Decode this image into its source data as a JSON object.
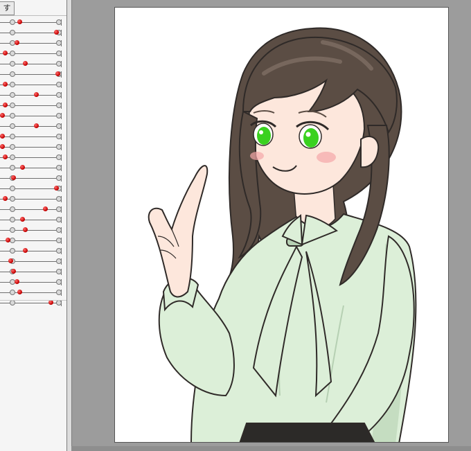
{
  "panel": {
    "tab_label": "す",
    "sliders": [
      {
        "value": 0.3
      },
      {
        "value": 0.95
      },
      {
        "value": 0.25
      },
      {
        "value": 0.05
      },
      {
        "value": 0.4
      },
      {
        "value": 0.98
      },
      {
        "value": 0.05
      },
      {
        "value": 0.6
      },
      {
        "value": 0.05
      },
      {
        "value": 0.0
      },
      {
        "value": 0.6
      },
      {
        "value": 0.0
      },
      {
        "value": 0.0
      },
      {
        "value": 0.05
      },
      {
        "value": 0.35
      },
      {
        "value": 0.2
      },
      {
        "value": 0.95
      },
      {
        "value": 0.05
      },
      {
        "value": 0.75
      },
      {
        "value": 0.35
      },
      {
        "value": 0.4
      },
      {
        "value": 0.1
      },
      {
        "value": 0.4
      },
      {
        "value": 0.15
      },
      {
        "value": 0.2
      },
      {
        "value": 0.25
      },
      {
        "value": 0.3
      },
      {
        "value": 0.85
      }
    ]
  },
  "canvas": {
    "subject": "anime-girl-illustration",
    "colors": {
      "hair": "#5b4d44",
      "hair_highlight": "#8a7a6e",
      "skin": "#fde7dc",
      "blouse": "#dcefd8",
      "blouse_shadow": "#b6d0b3",
      "eyes": "#3ad11f",
      "blush": "#f3a6a8",
      "outline": "#2f2a28",
      "skirt": "#2c2a28"
    }
  }
}
